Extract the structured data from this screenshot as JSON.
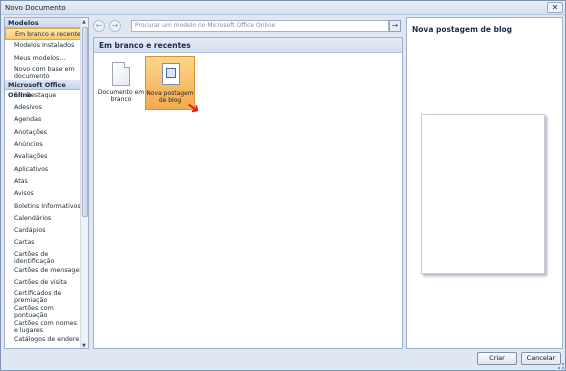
{
  "window": {
    "title": "Novo Documento",
    "close_glyph": "✕"
  },
  "sidebar": {
    "items": [
      {
        "type": "header",
        "label": "Modelos"
      },
      {
        "type": "item",
        "label": "Em branco e recentes",
        "selected": true
      },
      {
        "type": "item",
        "label": "Modelos Instalados"
      },
      {
        "type": "item",
        "label": "Meus modelos..."
      },
      {
        "type": "item",
        "label": "Novo com base em documento existente...",
        "double": true
      },
      {
        "type": "header",
        "label": "Microsoft Office Online"
      },
      {
        "type": "item",
        "label": "Em Destaque"
      },
      {
        "type": "item",
        "label": "Adesivos"
      },
      {
        "type": "item",
        "label": "Agendas"
      },
      {
        "type": "item",
        "label": "Anotações"
      },
      {
        "type": "item",
        "label": "Anúncios"
      },
      {
        "type": "item",
        "label": "Avaliações"
      },
      {
        "type": "item",
        "label": "Aplicativos"
      },
      {
        "type": "item",
        "label": "Atas"
      },
      {
        "type": "item",
        "label": "Avisos"
      },
      {
        "type": "item",
        "label": "Boletins Informativos"
      },
      {
        "type": "item",
        "label": "Calendários"
      },
      {
        "type": "item",
        "label": "Cardápios"
      },
      {
        "type": "item",
        "label": "Cartas"
      },
      {
        "type": "item",
        "label": "Cartões de identificação",
        "double": true
      },
      {
        "type": "item",
        "label": "Cartões de mensagem"
      },
      {
        "type": "item",
        "label": "Cartões de visita"
      },
      {
        "type": "item",
        "label": "Certificados de premiação",
        "double": true
      },
      {
        "type": "item",
        "label": "Cartões com pontuação",
        "double": true
      },
      {
        "type": "item",
        "label": "Cartões com nomes e lugares",
        "double": true
      },
      {
        "type": "item",
        "label": "Catálogos de endere..."
      }
    ]
  },
  "search": {
    "placeholder": "Procurar um modelo no Microsoft Office Online",
    "back_glyph": "←",
    "forward_glyph": "→",
    "go_glyph": "→"
  },
  "center": {
    "heading": "Em branco e recentes",
    "templates": [
      {
        "label": "Documento em branco"
      },
      {
        "label": "Nova postagem de blog",
        "selected": true
      }
    ]
  },
  "preview": {
    "title": "Nova postagem de blog"
  },
  "buttons": {
    "ok": "Criar",
    "cancel": "Cancelar"
  },
  "colors": {
    "selection": "#f4aa4d",
    "accent": "#1b2d4a",
    "pointer_arrow": "#e41b1b"
  }
}
